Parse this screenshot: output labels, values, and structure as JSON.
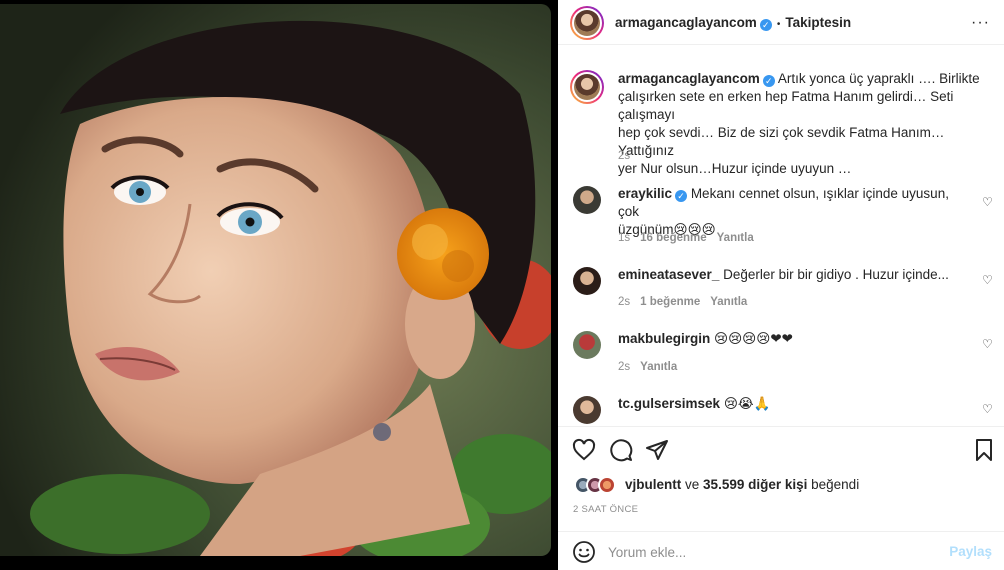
{
  "post": {
    "image_alt": "Portrait of a woman with blue eyes and an orange flower behind her ear",
    "author": "armagancaglayancom",
    "follow_state": "Takiptesin",
    "dot": "•",
    "more": "···"
  },
  "caption": {
    "author": "armagancaglayancom",
    "lines": [
      "Artık yonca üç yapraklı …. Birlikte",
      "çalışırken sete en erken hep Fatma Hanım gelirdi… Seti çalışmayı",
      "hep çok sevdi… Biz de sizi çok sevdik Fatma Hanım… Yattığınız",
      "yer Nur olsun…Huzur içinde uyuyun …"
    ],
    "time": "2s"
  },
  "comments": [
    {
      "user": "eraykilic",
      "verified": true,
      "text_line1": "Mekanı cennet olsun, ışıklar içinde uyusun, çok",
      "text_line2": "üzgünüm😢😢😢",
      "time": "1s",
      "likes": "16 beğenme",
      "reply": "Yanıtla"
    },
    {
      "user": "emineatasever_",
      "verified": false,
      "text_line1": "Değerler bir bir gidiyo . Huzur içinde...",
      "time": "2s",
      "likes": "1 beğenme",
      "reply": "Yanıtla"
    },
    {
      "user": "makbulegirgin",
      "verified": false,
      "text_line1": "😢😢😢😢❤❤",
      "time": "2s",
      "reply": "Yanıtla"
    },
    {
      "user": "tc.gulsersimsek",
      "verified": false,
      "text_line1": "😢😭🙏"
    }
  ],
  "likes": {
    "first_user": "vjbulentt",
    "joiner": "ve",
    "others": "35.599 diğer kişi",
    "suffix": "beğendi"
  },
  "timestamp": "2 SAAT ÖNCE",
  "comment_input": {
    "placeholder": "Yorum ekle...",
    "submit": "Paylaş"
  },
  "icons": [
    "heart-icon",
    "comment-icon",
    "share-icon",
    "bookmark-icon",
    "emoji-icon",
    "more-icon",
    "verified-icon"
  ],
  "colors": {
    "verified": "#3897f0",
    "muted": "#8e8e8e",
    "submit_disabled": "#b2dffc"
  }
}
